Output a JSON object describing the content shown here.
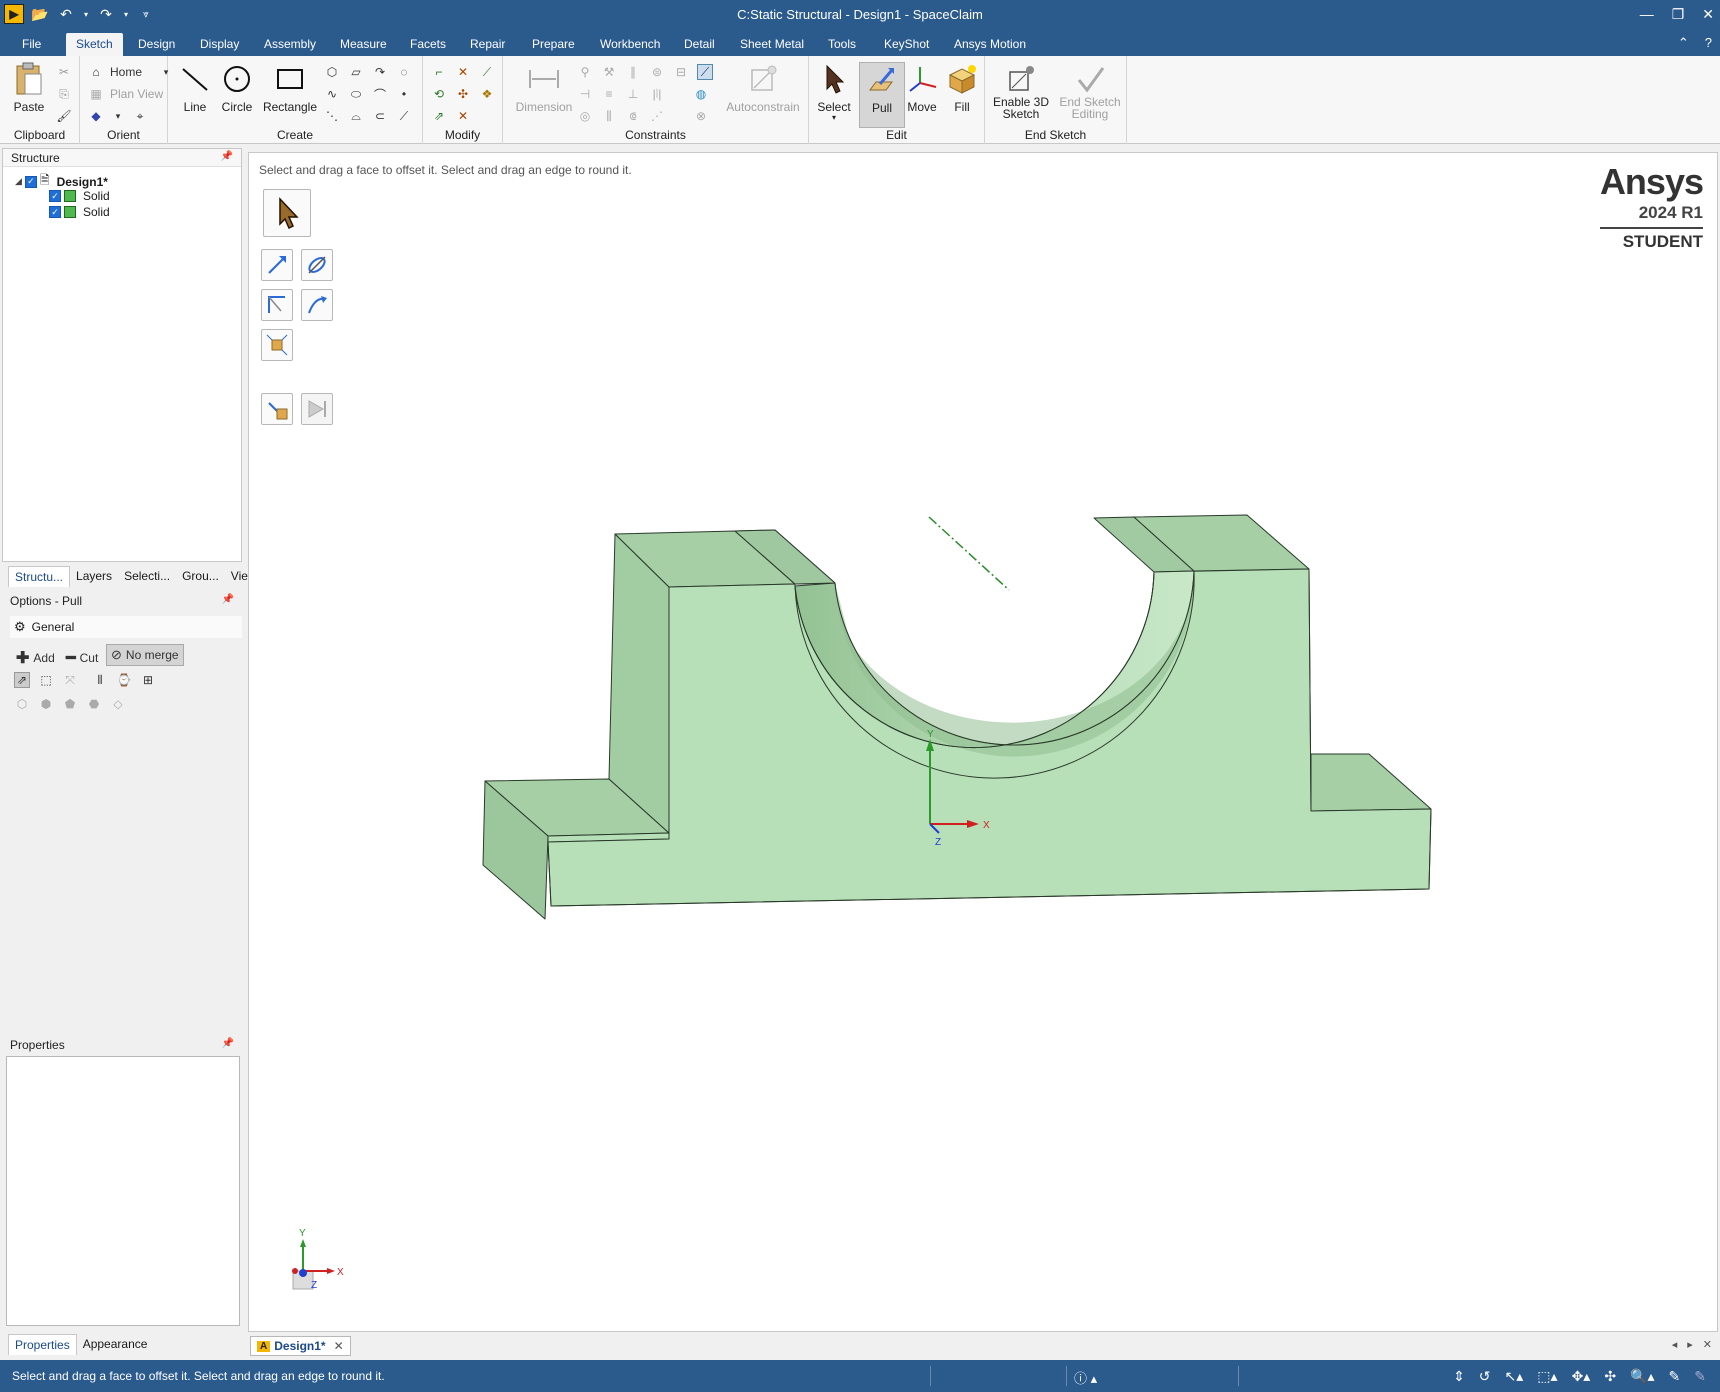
{
  "window": {
    "title": "C:Static Structural - Design1 - SpaceClaim"
  },
  "menu": {
    "tabs": [
      "File",
      "Sketch",
      "Design",
      "Display",
      "Assembly",
      "Measure",
      "Facets",
      "Repair",
      "Prepare",
      "Workbench",
      "Detail",
      "Sheet Metal",
      "Tools",
      "KeyShot",
      "Ansys Motion"
    ],
    "active": "Sketch"
  },
  "ribbon": {
    "clipboard": {
      "label": "Clipboard",
      "paste": "Paste"
    },
    "orient": {
      "label": "Orient",
      "home": "Home",
      "plan_view": "Plan View"
    },
    "create": {
      "label": "Create",
      "line": "Line",
      "circle": "Circle",
      "rectangle": "Rectangle"
    },
    "modify": {
      "label": "Modify"
    },
    "constraints": {
      "label": "Constraints",
      "dimension": "Dimension",
      "autoconstrain": "Autoconstrain"
    },
    "edit": {
      "label": "Edit",
      "select": "Select",
      "pull": "Pull",
      "move": "Move",
      "fill": "Fill"
    },
    "end_sketch": {
      "label": "End Sketch",
      "enable_3d": "Enable 3D Sketch",
      "end_editing": "End Sketch Editing"
    }
  },
  "structure": {
    "title": "Structure",
    "root": "Design1*",
    "children": [
      "Solid",
      "Solid"
    ],
    "tabs": [
      "Structu...",
      "Layers",
      "Selecti...",
      "Grou...",
      "Views"
    ]
  },
  "options": {
    "title": "Options - Pull",
    "general": "General",
    "add": "Add",
    "cut": "Cut",
    "no_merge": "No merge"
  },
  "properties": {
    "title": "Properties",
    "tabs": [
      "Properties",
      "Appearance"
    ]
  },
  "viewport": {
    "hint": "Select and drag a face to offset it. Select and drag an edge to round it.",
    "logo": {
      "brand": "Ansys",
      "version": "2024 R1",
      "edition": "STUDENT"
    },
    "axes": {
      "x": "X",
      "y": "Y",
      "z": "Z"
    }
  },
  "document_tab": {
    "label": "Design1*"
  },
  "status": {
    "text": "Select and drag a face to offset it. Select and drag an edge to round it."
  },
  "colors": {
    "accent": "#2b5a8c",
    "solid_fill": "#b8e0b8",
    "solid_edge": "#2a3a2a"
  }
}
